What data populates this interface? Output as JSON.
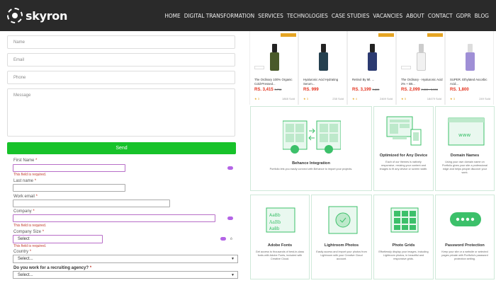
{
  "header": {
    "logo_text": "skyron",
    "nav": [
      "HOME",
      "DIGITAL TRANSFORMATION",
      "SERVICES",
      "TECHNOLOGIES",
      "CASE STUDIES",
      "VACANCIES",
      "ABOUT",
      "CONTACT",
      "GDPR",
      "BLOG"
    ]
  },
  "contact_form": {
    "name_placeholder": "Name",
    "email_placeholder": "Email",
    "phone_placeholder": "Phone",
    "message_placeholder": "Message",
    "send_label": "Send"
  },
  "lead_form": {
    "first_name_label": "First Name",
    "last_name_label": "Last name",
    "work_email_label": "Work email",
    "company_label": "Company",
    "company_size_label": "Company Size",
    "company_size_value": "Select",
    "country_label": "Country",
    "country_value": "Select...",
    "recruiting_label": "Do you work for a recruiting agency?",
    "recruiting_value": "Select...",
    "required_mark": "*",
    "error_text": "This field is required."
  },
  "products": [
    {
      "name": "The Ordinary 100% Organic Cold-Pressed...",
      "price": "RS. 3,415",
      "old_price": "3,796",
      "sold": "1868 Sold",
      "bottle_color": "#4a5a2a",
      "tag": true,
      "rating": "★ 3"
    },
    {
      "name": "Hyaluronic Acid Hydrating Serum...",
      "price": "RS. 999",
      "old_price": "",
      "sold": "238 Sold",
      "bottle_color": "#25404f",
      "tag": false,
      "rating": "★ 3"
    },
    {
      "name": "Retinol By Ml. ...",
      "price": "RS. 3,199",
      "old_price": "3,600",
      "sold": "2469 Sold",
      "bottle_color": "#2b3a70",
      "tag": true,
      "rating": "★ 4"
    },
    {
      "name": "The Ordinary - Hyaluronic Acid 2% + B5...",
      "price": "RS. 2,099",
      "old_price": "2,000 - 3,000",
      "sold": "18479 Sold",
      "bottle_color": "#f1f1f1",
      "tag": true,
      "rating": "★ 5"
    },
    {
      "name": "SUPER. Ethylated Ascorbic Acid...",
      "price": "RS. 1,800",
      "old_price": "",
      "sold": "249 Sold",
      "bottle_color": "#9f8fd6",
      "tag": false,
      "rating": "★ 3"
    }
  ],
  "features": [
    {
      "title": "Behance Integration",
      "desc": "Portfolio lets you easily connect with Behance to import your projects."
    },
    {
      "title": "Optimized for Any Device",
      "desc": "Each of our themes is natively responsive, resizing your content and images to fit any device or screen width."
    },
    {
      "title": "Domain Names",
      "desc": "Using your own domain name on Portfolio gives your site a professional edge and helps people discover your work."
    },
    {
      "title": "Adobe Fonts",
      "desc": "Get access to thousands of best-in-class fonts with Adobe Fonts, included with Creative Cloud."
    },
    {
      "title": "Lightroom Photos",
      "desc": "Easily access and import your photos from Lightroom with your Creative Cloud account."
    },
    {
      "title": "Photo Grids",
      "desc": "Effortlessly display your images, including Lightroom photos, in beautiful and responsive grids."
    },
    {
      "title": "Password Protection",
      "desc": "Keep your site or a website or selected pages private with Portfolio's password protection setting."
    }
  ],
  "colors": {
    "accent_green": "#17c22a",
    "error": "#c0392b",
    "price": "#e3301c",
    "header_bg": "#2a2a2a"
  }
}
